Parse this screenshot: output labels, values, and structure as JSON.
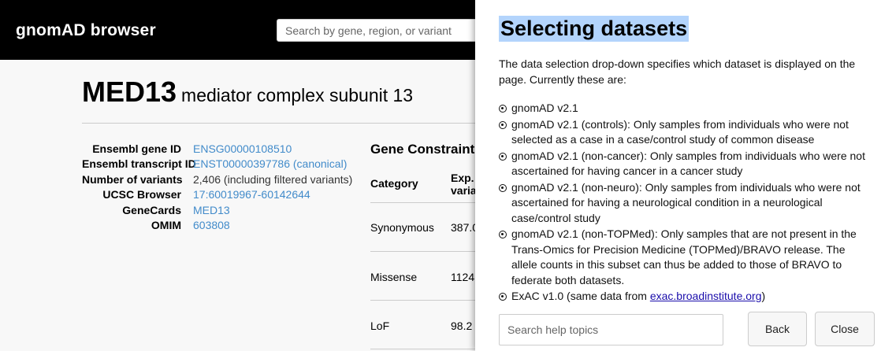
{
  "nav": {
    "brand": "gnomAD browser",
    "search_placeholder": "Search by gene, region, or variant"
  },
  "gene": {
    "symbol": "MED13",
    "name": "mediator complex subunit 13",
    "attributes": [
      {
        "key": "Ensembl gene ID",
        "value": "ENSG00000108510",
        "link": true
      },
      {
        "key": "Ensembl transcript ID",
        "value": "ENST00000397786 (canonical)",
        "link": true
      },
      {
        "key": "Number of variants",
        "value": "2,406 (including filtered variants)",
        "link": false
      },
      {
        "key": "UCSC Browser",
        "value": "17:60019967-60142644",
        "link": true
      },
      {
        "key": "GeneCards",
        "value": "MED13",
        "link": true
      },
      {
        "key": "OMIM",
        "value": "603808",
        "link": true
      }
    ]
  },
  "constraint": {
    "heading": "Gene Constraint",
    "col_category": "Category",
    "col_expected": "Exp. varia",
    "rows": [
      {
        "category": "Synonymous",
        "expected": "387.0"
      },
      {
        "category": "Missense",
        "expected": "1124"
      },
      {
        "category": "LoF",
        "expected": "98.2"
      }
    ]
  },
  "help": {
    "title": "Selecting datasets",
    "intro": "The data selection drop-down specifies which dataset is displayed on the page. Currently these are:",
    "items": [
      {
        "text": "gnomAD v2.1"
      },
      {
        "text": "gnomAD v2.1 (controls): Only samples from individuals who were not selected as a case in a case/control study of common disease"
      },
      {
        "text": "gnomAD v2.1 (non-cancer): Only samples from individuals who were not ascertained for having cancer in a cancer study"
      },
      {
        "text": "gnomAD v2.1 (non-neuro): Only samples from individuals who were not ascertained for having a neurological condition in a neurological case/control study"
      },
      {
        "text": "gnomAD v2.1 (non-TOPMed): Only samples that are not present in the Trans-Omics for Precision Medicine (TOPMed)/BRAVO release. The allele counts in this subset can thus be added to those of BRAVO to federate both datasets."
      },
      {
        "text": "ExAC v1.0 (same data from ",
        "link": "exac.broadinstitute.org",
        "suffix": ")"
      }
    ],
    "search_placeholder": "Search help topics",
    "back_label": "Back",
    "close_label": "Close"
  }
}
